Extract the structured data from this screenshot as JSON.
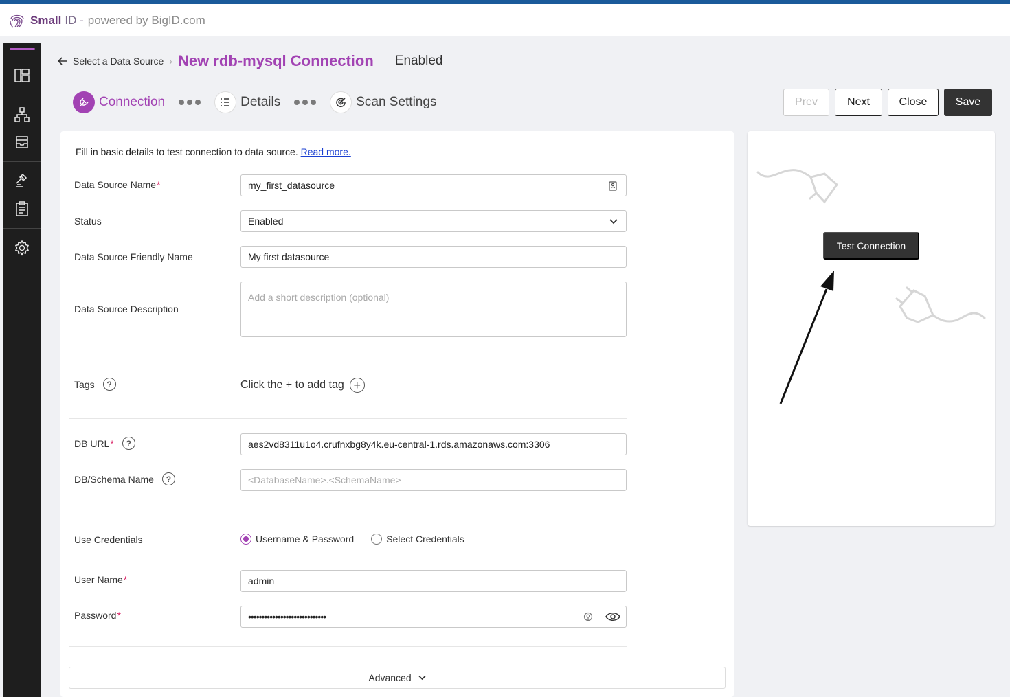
{
  "app": {
    "brand_name": "Small",
    "brand_suffix": "ID -",
    "brand_tagline": "powered by BigID.com"
  },
  "breadcrumb": {
    "back_label": "Select a Data Source",
    "title": "New rdb-mysql Connection",
    "status": "Enabled"
  },
  "stepper": {
    "steps": [
      {
        "label": "Connection",
        "active": true
      },
      {
        "label": "Details",
        "active": false
      },
      {
        "label": "Scan Settings",
        "active": false
      }
    ]
  },
  "toolbar": {
    "prev_label": "Prev",
    "next_label": "Next",
    "close_label": "Close",
    "save_label": "Save"
  },
  "form": {
    "intro_text": "Fill in basic details to test connection to data source.",
    "intro_link": "Read more.",
    "data_source_name": {
      "label": "Data Source Name",
      "value": "my_first_datasource"
    },
    "status": {
      "label": "Status",
      "value": "Enabled"
    },
    "friendly_name": {
      "label": "Data Source Friendly Name",
      "value": "My first datasource"
    },
    "description": {
      "label": "Data Source Description",
      "placeholder": "Add a short description (optional)"
    },
    "tags": {
      "label": "Tags",
      "hint": "Click the + to add tag"
    },
    "db_url": {
      "label": "DB URL",
      "value": "aes2vd8311u1o4.crufnxbg8y4k.eu-central-1.rds.amazonaws.com:3306"
    },
    "schema_name": {
      "label": "DB/Schema Name",
      "placeholder": "<DatabaseName>.<SchemaName>"
    },
    "use_credentials": {
      "label": "Use Credentials",
      "options": [
        {
          "label": "Username & Password",
          "selected": true
        },
        {
          "label": "Select Credentials",
          "selected": false
        }
      ]
    },
    "user_name": {
      "label": "User Name",
      "value": "admin"
    },
    "password": {
      "label": "Password",
      "value": "•••••••••••••••••••••••••••••"
    },
    "advanced_label": "Advanced"
  },
  "test_panel": {
    "button_label": "Test Connection"
  },
  "colors": {
    "accent": "#a243b3",
    "topbar_stripe": "#1a5a9a",
    "sidebar_bg": "#1e1e1e",
    "required": "#d81b60"
  },
  "icons": {
    "brand": "fingerprint-icon",
    "sidebar": [
      "dashboard-icon",
      "hierarchy-icon",
      "inbox-icon",
      "gavel-icon",
      "clipboard-icon",
      "gear-icon"
    ]
  }
}
